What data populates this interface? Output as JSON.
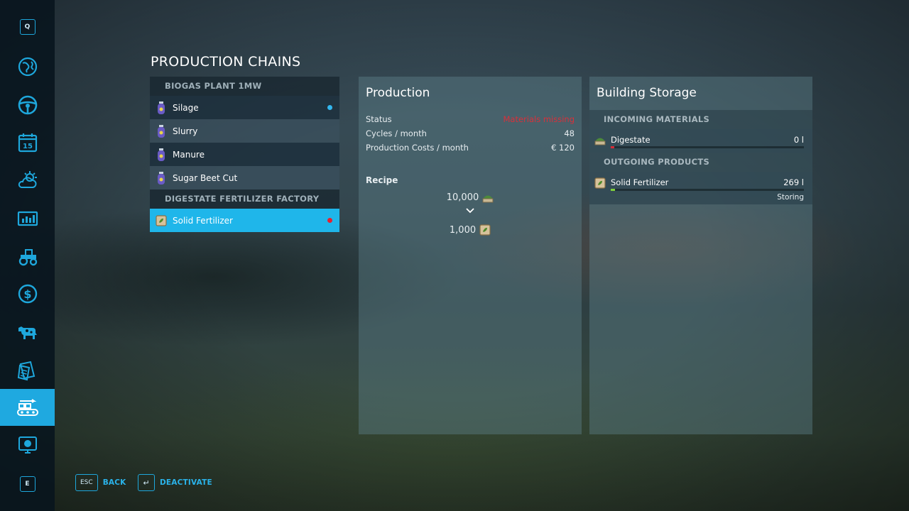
{
  "sidebar": {
    "top_key": "Q",
    "bottom_key": "E",
    "calendar_day": "15",
    "items": [
      {
        "name": "map-globe-icon"
      },
      {
        "name": "steering-wheel-icon"
      },
      {
        "name": "calendar-icon"
      },
      {
        "name": "weather-icon"
      },
      {
        "name": "statistics-icon"
      },
      {
        "name": "tractor-icon"
      },
      {
        "name": "finances-icon"
      },
      {
        "name": "animals-icon"
      },
      {
        "name": "contracts-icon"
      },
      {
        "name": "production-icon",
        "active": true
      },
      {
        "name": "help-icon"
      }
    ],
    "accent": "#1fa9e0"
  },
  "page": {
    "title": "PRODUCTION CHAINS"
  },
  "chains": {
    "groups": [
      {
        "header": "BIOGAS PLANT 1MW",
        "items": [
          {
            "label": "Silage",
            "dot": "#33b8f0"
          },
          {
            "label": "Slurry"
          },
          {
            "label": "Manure"
          },
          {
            "label": "Sugar Beet Cut"
          }
        ]
      },
      {
        "header": "DIGESTATE FERTILIZER FACTORY",
        "items": [
          {
            "label": "Solid Fertilizer",
            "dot": "#e8202e",
            "selected": true
          }
        ]
      }
    ]
  },
  "production": {
    "title": "Production",
    "status_label": "Status",
    "status_value": "Materials missing",
    "cycles_label": "Cycles / month",
    "cycles_value": "48",
    "costs_label": "Production Costs / month",
    "costs_value": "€ 120",
    "recipe_label": "Recipe",
    "recipe_input_amount": "10,000",
    "recipe_output_amount": "1,000"
  },
  "storage": {
    "title": "Building Storage",
    "incoming_header": "INCOMING MATERIALS",
    "incoming": [
      {
        "label": "Digestate",
        "amount": "0 l",
        "fill": 0.0,
        "bar_color": "#d62a36"
      }
    ],
    "outgoing_header": "OUTGOING PRODUCTS",
    "outgoing": [
      {
        "label": "Solid Fertilizer",
        "amount": "269 l",
        "fill": 0.02,
        "bar_color": "#7fd13b",
        "mode": "Storing"
      }
    ]
  },
  "footer": {
    "back_key": "ESC",
    "back_label": "BACK",
    "deactivate_key": "↵",
    "deactivate_label": "DEACTIVATE"
  }
}
